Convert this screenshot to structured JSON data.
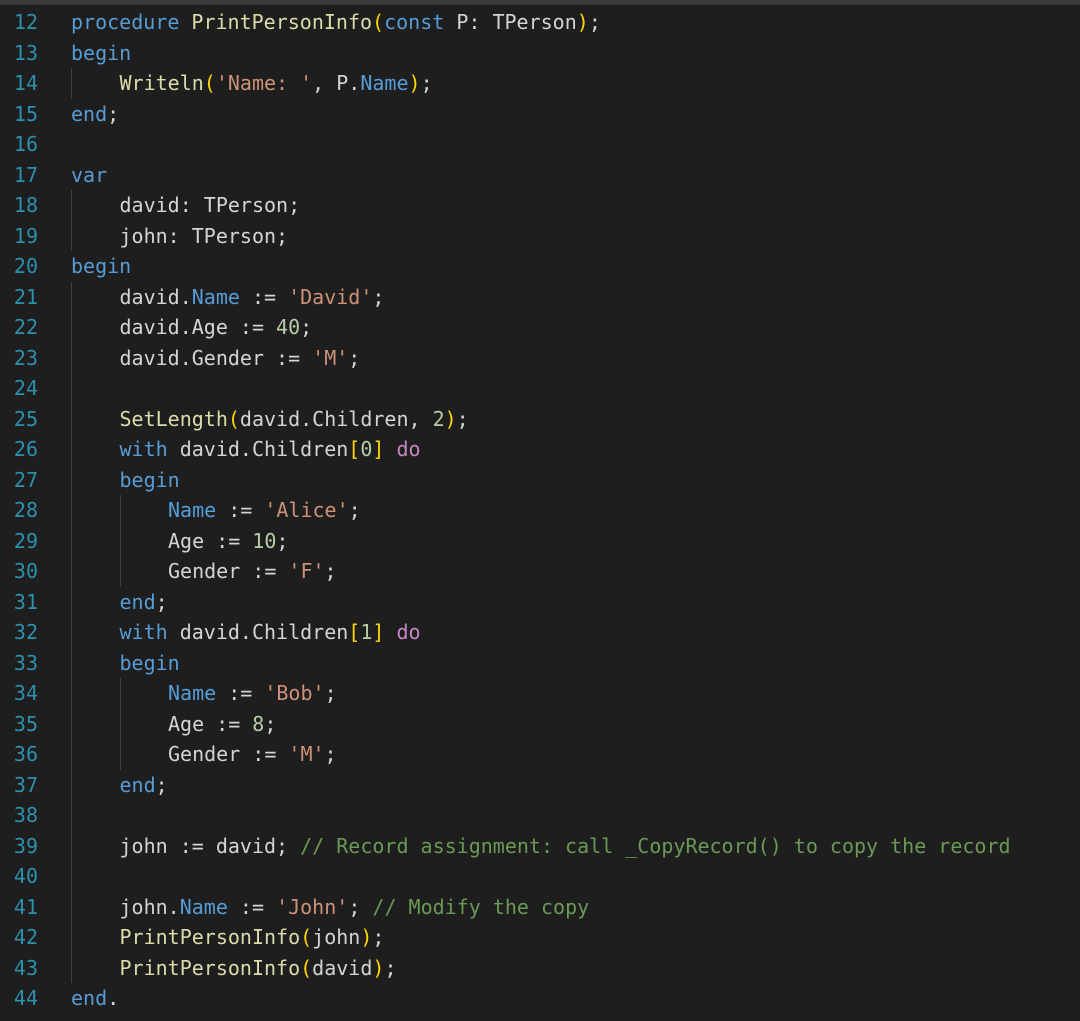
{
  "editor": {
    "theme_colors": {
      "background": "#1e1e1e",
      "line_number": "#2b91af",
      "keyword": "#569cd6",
      "control_keyword": "#c586c0",
      "function": "#dcdcaa",
      "string": "#ce9178",
      "number": "#b5cea8",
      "comment": "#6a9955",
      "bracket_level1": "#ffd700"
    },
    "lines": [
      {
        "n": "12",
        "indent": 0,
        "tokens": [
          {
            "t": "procedure",
            "c": "kw"
          },
          {
            "t": " ",
            "c": "pn"
          },
          {
            "t": "PrintPersonInfo",
            "c": "fn"
          },
          {
            "t": "(",
            "c": "br1"
          },
          {
            "t": "const",
            "c": "kw"
          },
          {
            "t": " P: TPerson",
            "c": "var"
          },
          {
            "t": ")",
            "c": "br1"
          },
          {
            "t": ";",
            "c": "pn"
          }
        ]
      },
      {
        "n": "13",
        "indent": 0,
        "tokens": [
          {
            "t": "begin",
            "c": "kw"
          }
        ]
      },
      {
        "n": "14",
        "indent": 1,
        "tokens": [
          {
            "t": "Writeln",
            "c": "fn"
          },
          {
            "t": "(",
            "c": "br1"
          },
          {
            "t": "'Name: '",
            "c": "str"
          },
          {
            "t": ", P.",
            "c": "var"
          },
          {
            "t": "Name",
            "c": "prop"
          },
          {
            "t": ")",
            "c": "br1"
          },
          {
            "t": ";",
            "c": "pn"
          }
        ]
      },
      {
        "n": "15",
        "indent": 0,
        "tokens": [
          {
            "t": "end",
            "c": "kw"
          },
          {
            "t": ";",
            "c": "pn"
          }
        ]
      },
      {
        "n": "16",
        "indent": 0,
        "tokens": []
      },
      {
        "n": "17",
        "indent": 0,
        "tokens": [
          {
            "t": "var",
            "c": "kw"
          }
        ]
      },
      {
        "n": "18",
        "indent": 1,
        "tokens": [
          {
            "t": "david: TPerson;",
            "c": "var"
          }
        ]
      },
      {
        "n": "19",
        "indent": 1,
        "tokens": [
          {
            "t": "john: TPerson;",
            "c": "var"
          }
        ]
      },
      {
        "n": "20",
        "indent": 0,
        "tokens": [
          {
            "t": "begin",
            "c": "kw"
          }
        ]
      },
      {
        "n": "21",
        "indent": 1,
        "tokens": [
          {
            "t": "david.",
            "c": "var"
          },
          {
            "t": "Name",
            "c": "prop"
          },
          {
            "t": " := ",
            "c": "op"
          },
          {
            "t": "'David'",
            "c": "str"
          },
          {
            "t": ";",
            "c": "pn"
          }
        ]
      },
      {
        "n": "22",
        "indent": 1,
        "tokens": [
          {
            "t": "david.Age := ",
            "c": "var"
          },
          {
            "t": "40",
            "c": "num"
          },
          {
            "t": ";",
            "c": "pn"
          }
        ]
      },
      {
        "n": "23",
        "indent": 1,
        "tokens": [
          {
            "t": "david.Gender := ",
            "c": "var"
          },
          {
            "t": "'M'",
            "c": "str"
          },
          {
            "t": ";",
            "c": "pn"
          }
        ]
      },
      {
        "n": "24",
        "indent": 1,
        "tokens": []
      },
      {
        "n": "25",
        "indent": 1,
        "tokens": [
          {
            "t": "SetLength",
            "c": "fn"
          },
          {
            "t": "(",
            "c": "br1"
          },
          {
            "t": "david.Children, ",
            "c": "var"
          },
          {
            "t": "2",
            "c": "num"
          },
          {
            "t": ")",
            "c": "br1"
          },
          {
            "t": ";",
            "c": "pn"
          }
        ]
      },
      {
        "n": "26",
        "indent": 1,
        "tokens": [
          {
            "t": "with",
            "c": "kw"
          },
          {
            "t": " david.Children",
            "c": "var"
          },
          {
            "t": "[",
            "c": "br1"
          },
          {
            "t": "0",
            "c": "num"
          },
          {
            "t": "]",
            "c": "br1"
          },
          {
            "t": " ",
            "c": "pn"
          },
          {
            "t": "do",
            "c": "kw2"
          }
        ]
      },
      {
        "n": "27",
        "indent": 1,
        "tokens": [
          {
            "t": "begin",
            "c": "kw"
          }
        ]
      },
      {
        "n": "28",
        "indent": 2,
        "tokens": [
          {
            "t": "Name",
            "c": "prop"
          },
          {
            "t": " := ",
            "c": "op"
          },
          {
            "t": "'Alice'",
            "c": "str"
          },
          {
            "t": ";",
            "c": "pn"
          }
        ]
      },
      {
        "n": "29",
        "indent": 2,
        "tokens": [
          {
            "t": "Age := ",
            "c": "var"
          },
          {
            "t": "10",
            "c": "num"
          },
          {
            "t": ";",
            "c": "pn"
          }
        ]
      },
      {
        "n": "30",
        "indent": 2,
        "tokens": [
          {
            "t": "Gender := ",
            "c": "var"
          },
          {
            "t": "'F'",
            "c": "str"
          },
          {
            "t": ";",
            "c": "pn"
          }
        ]
      },
      {
        "n": "31",
        "indent": 1,
        "tokens": [
          {
            "t": "end",
            "c": "kw"
          },
          {
            "t": ";",
            "c": "pn"
          }
        ]
      },
      {
        "n": "32",
        "indent": 1,
        "tokens": [
          {
            "t": "with",
            "c": "kw"
          },
          {
            "t": " david.Children",
            "c": "var"
          },
          {
            "t": "[",
            "c": "br1"
          },
          {
            "t": "1",
            "c": "num"
          },
          {
            "t": "]",
            "c": "br1"
          },
          {
            "t": " ",
            "c": "pn"
          },
          {
            "t": "do",
            "c": "kw2"
          }
        ]
      },
      {
        "n": "33",
        "indent": 1,
        "tokens": [
          {
            "t": "begin",
            "c": "kw"
          }
        ]
      },
      {
        "n": "34",
        "indent": 2,
        "tokens": [
          {
            "t": "Name",
            "c": "prop"
          },
          {
            "t": " := ",
            "c": "op"
          },
          {
            "t": "'Bob'",
            "c": "str"
          },
          {
            "t": ";",
            "c": "pn"
          }
        ]
      },
      {
        "n": "35",
        "indent": 2,
        "tokens": [
          {
            "t": "Age := ",
            "c": "var"
          },
          {
            "t": "8",
            "c": "num"
          },
          {
            "t": ";",
            "c": "pn"
          }
        ]
      },
      {
        "n": "36",
        "indent": 2,
        "tokens": [
          {
            "t": "Gender := ",
            "c": "var"
          },
          {
            "t": "'M'",
            "c": "str"
          },
          {
            "t": ";",
            "c": "pn"
          }
        ]
      },
      {
        "n": "37",
        "indent": 1,
        "tokens": [
          {
            "t": "end",
            "c": "kw"
          },
          {
            "t": ";",
            "c": "pn"
          }
        ]
      },
      {
        "n": "38",
        "indent": 1,
        "tokens": []
      },
      {
        "n": "39",
        "indent": 1,
        "tokens": [
          {
            "t": "john := david; ",
            "c": "var"
          },
          {
            "t": "// Record assignment: call _CopyRecord() to copy the record",
            "c": "cm"
          }
        ]
      },
      {
        "n": "40",
        "indent": 1,
        "tokens": []
      },
      {
        "n": "41",
        "indent": 1,
        "tokens": [
          {
            "t": "john.",
            "c": "var"
          },
          {
            "t": "Name",
            "c": "prop"
          },
          {
            "t": " := ",
            "c": "op"
          },
          {
            "t": "'John'",
            "c": "str"
          },
          {
            "t": "; ",
            "c": "pn"
          },
          {
            "t": "// Modify the copy",
            "c": "cm"
          }
        ]
      },
      {
        "n": "42",
        "indent": 1,
        "tokens": [
          {
            "t": "PrintPersonInfo",
            "c": "fn"
          },
          {
            "t": "(",
            "c": "br1"
          },
          {
            "t": "john",
            "c": "var"
          },
          {
            "t": ")",
            "c": "br1"
          },
          {
            "t": ";",
            "c": "pn"
          }
        ]
      },
      {
        "n": "43",
        "indent": 1,
        "tokens": [
          {
            "t": "PrintPersonInfo",
            "c": "fn"
          },
          {
            "t": "(",
            "c": "br1"
          },
          {
            "t": "david",
            "c": "var"
          },
          {
            "t": ")",
            "c": "br1"
          },
          {
            "t": ";",
            "c": "pn"
          }
        ]
      },
      {
        "n": "44",
        "indent": 0,
        "tokens": [
          {
            "t": "end",
            "c": "kw"
          },
          {
            "t": ".",
            "c": "pn"
          }
        ]
      }
    ]
  }
}
